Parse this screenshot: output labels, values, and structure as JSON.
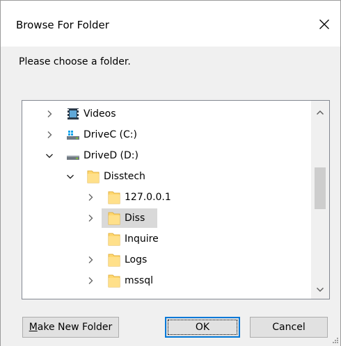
{
  "window": {
    "title": "Browse For Folder",
    "close_icon": "close-icon"
  },
  "prompt": "Please choose a folder.",
  "tree": {
    "items": [
      {
        "label": "Videos",
        "icon": "videos-folder-icon",
        "expand": "collapsed",
        "level": 0
      },
      {
        "label": "DriveC (C:)",
        "icon": "windows-drive-icon",
        "expand": "collapsed",
        "level": 0
      },
      {
        "label": "DriveD (D:)",
        "icon": "drive-icon",
        "expand": "expanded",
        "level": 0
      },
      {
        "label": "Disstech",
        "icon": "folder-icon",
        "expand": "expanded",
        "level": 1
      },
      {
        "label": "127.0.0.1",
        "icon": "folder-icon",
        "expand": "collapsed",
        "level": 2
      },
      {
        "label": "Diss",
        "icon": "folder-icon",
        "expand": "collapsed",
        "level": 2,
        "selected": true
      },
      {
        "label": "Inquire",
        "icon": "folder-icon",
        "expand": "none",
        "level": 2
      },
      {
        "label": "Logs",
        "icon": "folder-icon",
        "expand": "collapsed",
        "level": 2
      },
      {
        "label": "mssql",
        "icon": "folder-icon",
        "expand": "collapsed",
        "level": 2
      }
    ]
  },
  "buttons": {
    "make_new_folder": "Make New Folder",
    "ok": "OK",
    "cancel": "Cancel"
  },
  "colors": {
    "accent": "#0078d7",
    "folder": "#ffd76e",
    "selection": "#d9d9d9"
  }
}
